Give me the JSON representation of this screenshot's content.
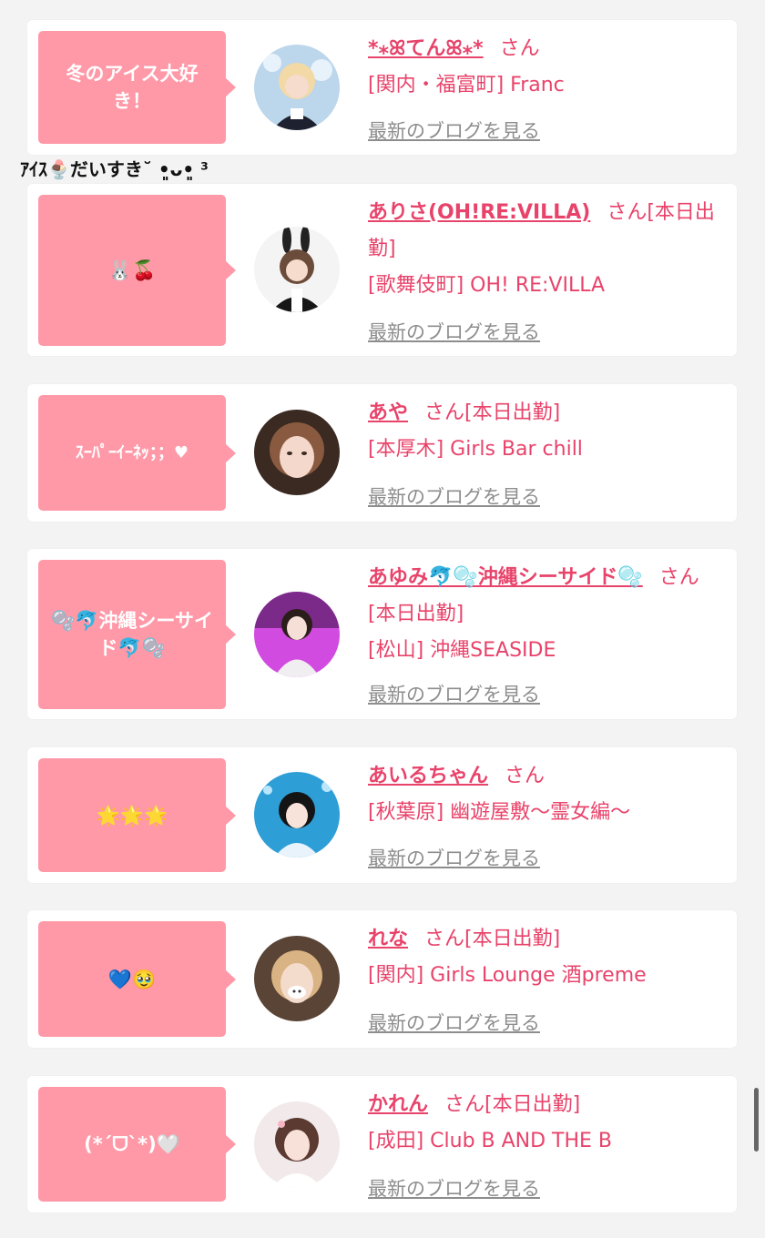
{
  "caption": "ｱｲｽ🍨だいすき˘ •͈ᴗ•͈ ³",
  "blog_label": "最新のブログを見る",
  "san_label": "さん",
  "entries": [
    {
      "bubble": "冬のアイス大好き！",
      "name": "*⁎ꕤてんꕤ⁎*",
      "status": "",
      "shop": "[関内・福富町] Franc"
    },
    {
      "bubble": "🐰🍒",
      "name": "ありさ(OH!RE:VILLA)",
      "status": "[本日出勤]",
      "shop": "[歌舞伎町] OH! RE:VILLA"
    },
    {
      "bubble": "ｽｰﾊﾟｰｲｰﾈｯ；；♥",
      "name": "あや",
      "status": "[本日出勤]",
      "shop": "[本厚木] Girls Bar chill"
    },
    {
      "bubble": "🫧🐬沖縄シーサイド🐬🫧",
      "name": "あゆみ🐬🫧沖縄シーサイド🫧",
      "status": "[本日出勤]",
      "shop": "[松山] 沖縄SEASIDE"
    },
    {
      "bubble": "🌟🌟🌟",
      "name": "あいるちゃん",
      "status": "",
      "shop": "[秋葉原] 幽遊屋敷〜霊女編〜"
    },
    {
      "bubble": "💙🥹",
      "name": "れな",
      "status": "[本日出勤]",
      "shop": "[関内] Girls Lounge 酒preme"
    },
    {
      "bubble": "(*ˊᗜˋ*)🤍",
      "name": "かれん",
      "status": "[本日出勤]",
      "shop": "[成田] Club B AND THE B"
    }
  ]
}
